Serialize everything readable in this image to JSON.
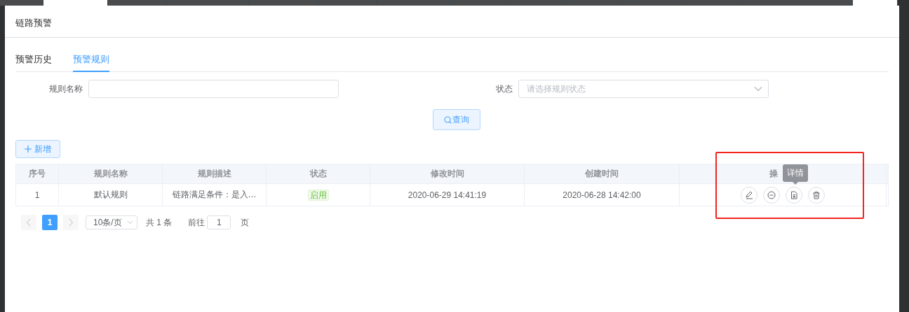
{
  "top_strip": {
    "tabs": [
      {
        "selected": false
      },
      {
        "selected": true
      },
      {
        "selected": false
      },
      {
        "selected": false
      },
      {
        "selected": false
      },
      {
        "selected": false
      },
      {
        "selected": false
      },
      {
        "selected": false
      },
      {
        "selected": false
      },
      {
        "selected": false
      },
      {
        "selected": false
      },
      {
        "selected": false
      },
      {
        "selected": false
      },
      {
        "selected": true
      }
    ]
  },
  "panel": {
    "title": "链路预警"
  },
  "tabs": [
    {
      "label": "预警历史",
      "selected": false
    },
    {
      "label": "预警规则",
      "selected": true
    }
  ],
  "filters": [
    {
      "label": "规则名称",
      "kind": "input"
    },
    {
      "label": "状态",
      "kind": "select",
      "placeholder": "请选择规则状态"
    }
  ],
  "query_button": "查询",
  "add_button": "新增",
  "table": {
    "columns": [
      "序号",
      "规则名称",
      "规则描述",
      "状态",
      "修改时间",
      "创建时间",
      "操"
    ],
    "rows": [
      {
        "index": "1",
        "name": "默认规则",
        "description": "链路满足条件：是入…",
        "status": "启用",
        "enabled": true,
        "modified": "2020-06-29 14:41:19",
        "created": "2020-06-28 14:42:00",
        "actions": [
          {
            "kind": "edit"
          },
          {
            "kind": "disable"
          },
          {
            "kind": "detail",
            "tooltip": "详情"
          },
          {
            "kind": "delete"
          }
        ]
      }
    ]
  },
  "pagination": {
    "prev_disabled": true,
    "pages": [
      {
        "label": "1",
        "selected": true
      }
    ],
    "next_disabled": true,
    "page_size": "10条/页",
    "total": "共 1 条",
    "goto_label": "前往",
    "goto_value": "1",
    "goto_suffix": "页"
  },
  "highlight": {
    "shown": true
  }
}
